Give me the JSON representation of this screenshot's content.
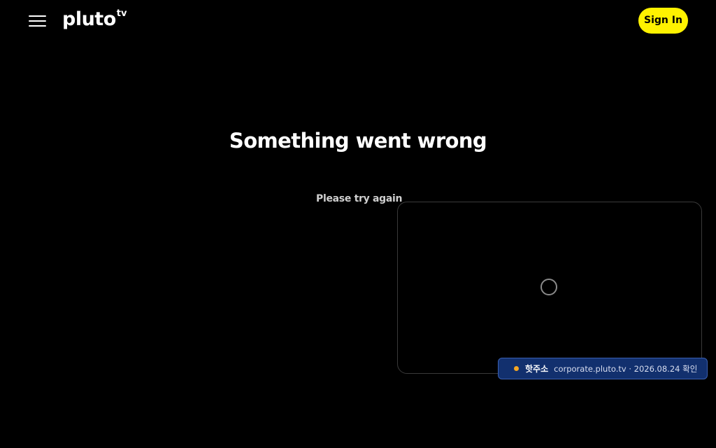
{
  "header": {
    "menu_icon": "hamburger-menu-icon",
    "logo_text": "pluto",
    "logo_superscript": "tv",
    "signin_label": "Sign In"
  },
  "main": {
    "title": "Something went wrong",
    "subtitle": "Please try again"
  },
  "player": {
    "loading_icon": "loading-spinner-icon"
  },
  "toast": {
    "title": "핫주소",
    "detail": "corporate.pluto.tv · 2026.08.24 확인"
  },
  "colors": {
    "background": "#000000",
    "accent_yellow": "#fff200",
    "toast_background": "#12306e",
    "toast_dot": "#f5a623"
  }
}
